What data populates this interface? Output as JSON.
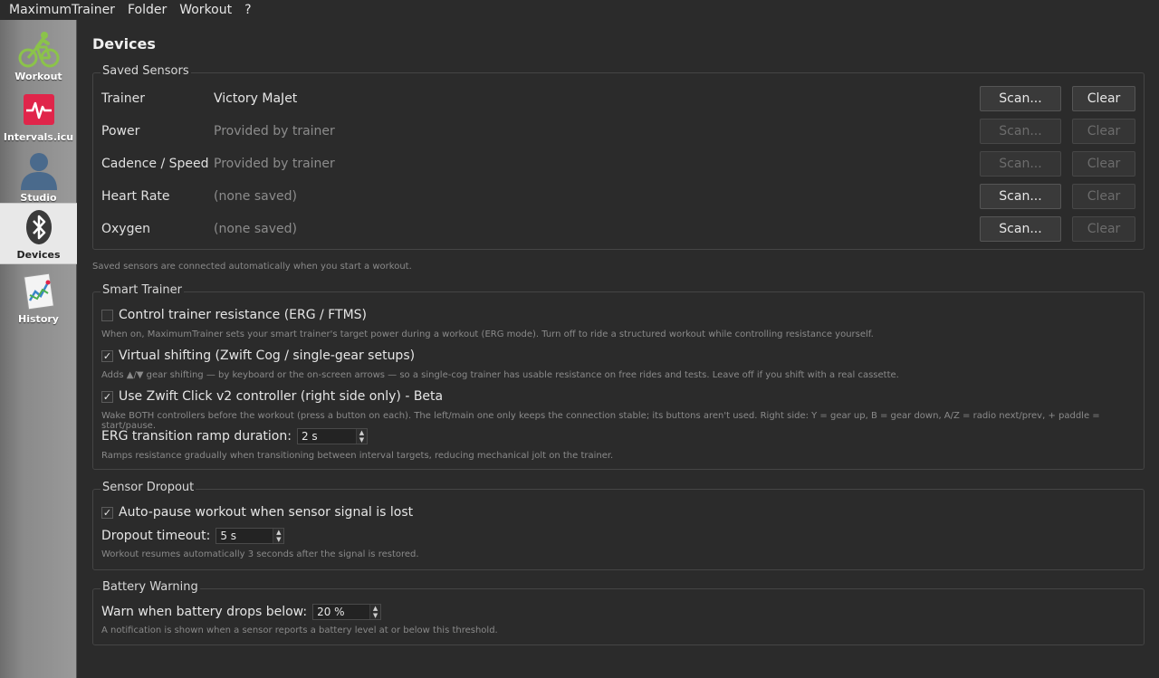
{
  "menu": {
    "app": "MaximumTrainer",
    "folder": "Folder",
    "workout": "Workout",
    "help": "?"
  },
  "sidebar": {
    "items": [
      {
        "label": "Workout",
        "icon": "cyclist-icon"
      },
      {
        "label": "Intervals.icu",
        "icon": "heartbeat-icon"
      },
      {
        "label": "Studio",
        "icon": "person-icon"
      },
      {
        "label": "Devices",
        "icon": "bluetooth-icon",
        "active": true
      },
      {
        "label": "History",
        "icon": "chart-history-icon"
      }
    ]
  },
  "page": {
    "title": "Devices"
  },
  "saved_sensors": {
    "title": "Saved Sensors",
    "rows": [
      {
        "key": "Trainer",
        "value": "Victory MaJet",
        "scan": "Scan...",
        "clear": "Clear",
        "scan_enabled": true,
        "clear_enabled": true
      },
      {
        "key": "Power",
        "value": "Provided by trainer",
        "scan": "Scan...",
        "clear": "Clear",
        "scan_enabled": false,
        "clear_enabled": false
      },
      {
        "key": "Cadence / Speed",
        "value": "Provided by trainer",
        "scan": "Scan...",
        "clear": "Clear",
        "scan_enabled": false,
        "clear_enabled": false
      },
      {
        "key": "Heart Rate",
        "value": "(none saved)",
        "scan": "Scan...",
        "clear": "Clear",
        "scan_enabled": true,
        "clear_enabled": false
      },
      {
        "key": "Oxygen",
        "value": "(none saved)",
        "scan": "Scan...",
        "clear": "Clear",
        "scan_enabled": true,
        "clear_enabled": false
      }
    ],
    "note": "Saved sensors are connected automatically when you start a workout."
  },
  "smart_trainer": {
    "title": "Smart Trainer",
    "erg": {
      "label": "Control trainer resistance (ERG / FTMS)",
      "checked": false,
      "note": "When on, MaximumTrainer sets your smart trainer's target power during a workout (ERG mode). Turn off to ride a structured workout while controlling resistance yourself."
    },
    "virtual_shifting": {
      "label": "Virtual shifting (Zwift Cog / single-gear setups)",
      "checked": true,
      "note": "Adds ▲/▼ gear shifting — by keyboard or the on-screen arrows — so a single-cog trainer has usable resistance on free rides and tests. Leave off if you shift with a real cassette."
    },
    "zwift_click": {
      "label": "Use Zwift Click v2 controller (right side only) - Beta",
      "checked": true,
      "note": "Wake BOTH controllers before the workout (press a button on each). The left/main one only keeps the connection stable; its buttons aren't used. Right side: Y = gear up, B = gear down, A/Z = radio next/prev, + paddle = start/pause."
    },
    "ramp": {
      "label": "ERG transition ramp duration:",
      "value": "2 s",
      "note": "Ramps resistance gradually when transitioning between interval targets, reducing mechanical jolt on the trainer."
    }
  },
  "sensor_dropout": {
    "title": "Sensor Dropout",
    "autopause": {
      "label": "Auto-pause workout when sensor signal is lost",
      "checked": true
    },
    "timeout": {
      "label": "Dropout timeout:",
      "value": "5 s"
    },
    "note": "Workout resumes automatically 3 seconds after the signal is restored."
  },
  "battery": {
    "title": "Battery Warning",
    "warn": {
      "label": "Warn when battery drops below:",
      "value": "20 %"
    },
    "note": "A notification is shown when a sensor reports a battery level at or below this threshold."
  },
  "colors": {
    "background": "#2b2b2b",
    "accent_red": "#e0254a",
    "cyclist_green": "#8bc34a"
  }
}
